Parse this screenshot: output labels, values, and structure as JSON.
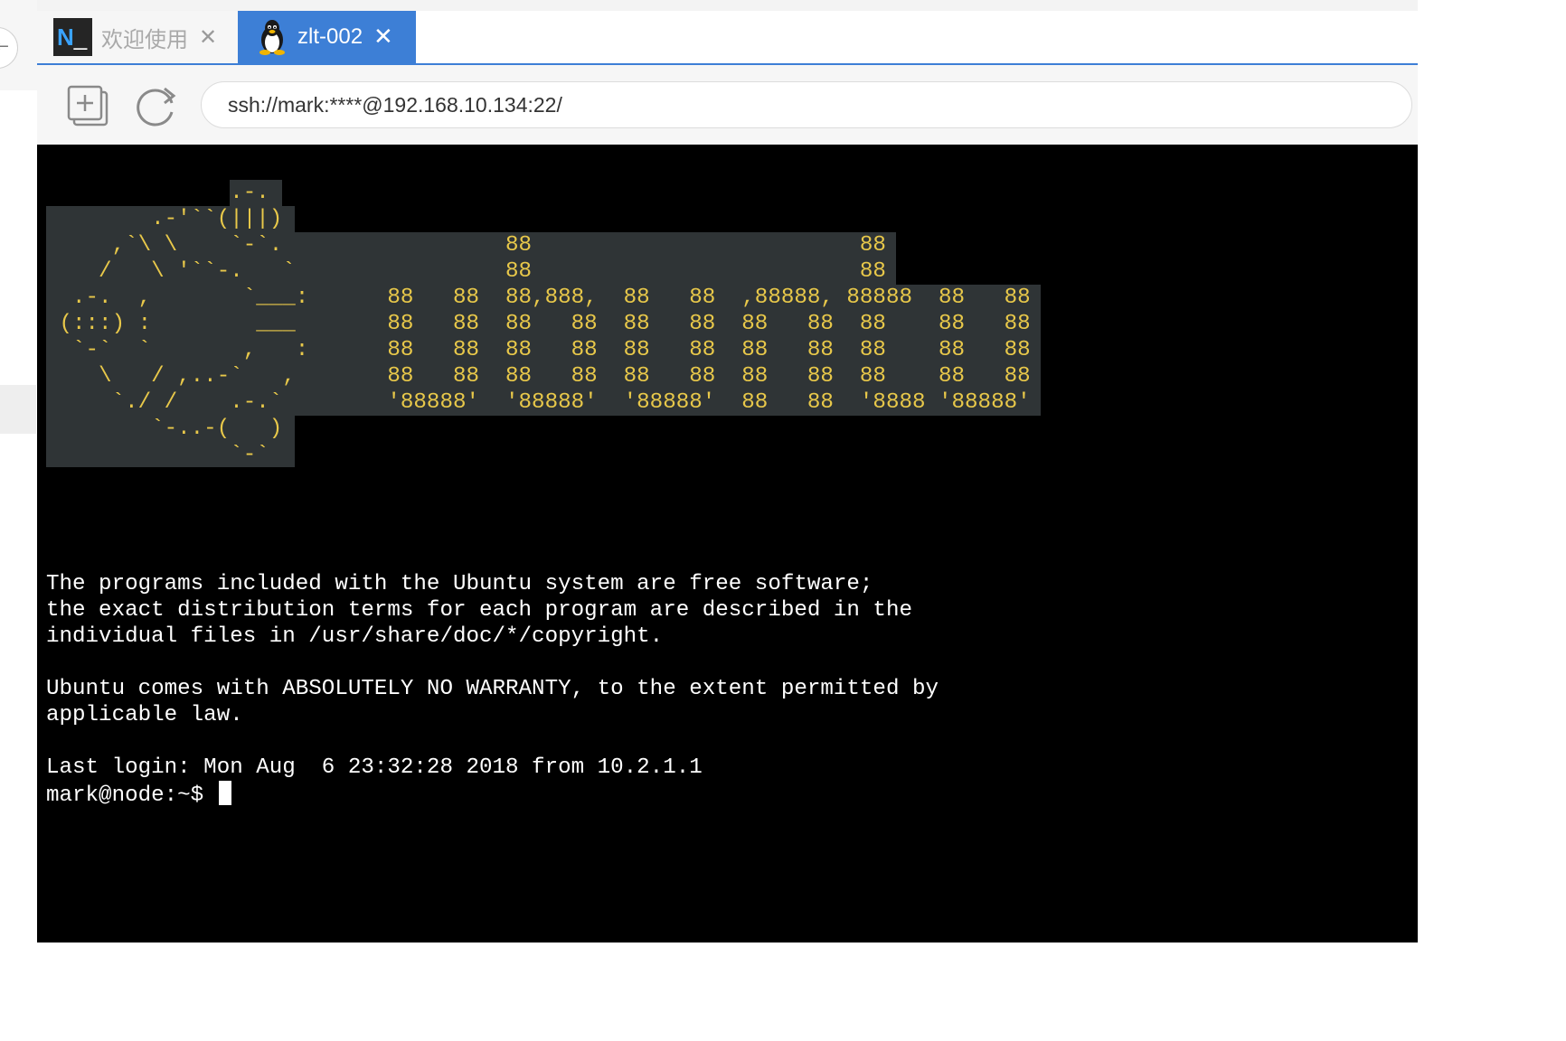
{
  "tabs": [
    {
      "label": "欢迎使用",
      "icon": "nxshell-logo-icon",
      "logo_text": "N",
      "active": false
    },
    {
      "label": "zlt-002",
      "icon": "linux-penguin-icon",
      "active": true
    }
  ],
  "toolbar": {
    "new_tab_icon": "new-tab-icon",
    "refresh_icon": "refresh-icon",
    "address": "ssh://mark:****@192.168.10.134:22/"
  },
  "terminal": {
    "ascii_logo": [
      "              .-.",
      "        .-'``(|||)",
      "     ,`\\ \\    `-`.                 88                         88",
      "    /   \\ '``-.   `                88                         88",
      "  .-.  ,       `___:      88   88  88,888,  88   88  ,88888, 88888  88   88",
      " (:::) :        ___       88   88  88   88  88   88  88   88  88    88   88",
      "  `-`  `       ,   :      88   88  88   88  88   88  88   88  88    88   88",
      "    \\   / ,..-`   ,       88   88  88   88  88   88  88   88  88    88   88",
      "     `./ /    .-.`        '88888'  '88888'  '88888'  88   88  '8888 '88888'",
      "        `-..-(   )",
      "              `-`"
    ],
    "motd": [
      "The programs included with the Ubuntu system are free software;",
      "the exact distribution terms for each program are described in the",
      "individual files in /usr/share/doc/*/copyright.",
      "",
      "Ubuntu comes with ABSOLUTELY NO WARRANTY, to the extent permitted by",
      "applicable law.",
      "",
      "Last login: Mon Aug  6 23:32:28 2018 from 10.2.1.1"
    ],
    "prompt": "mark@node:~$ "
  },
  "colors": {
    "accent": "#3d7fd6",
    "terminal_bg": "#000000",
    "logo_bg": "#2f3436",
    "logo_fg": "#e8c84a"
  }
}
